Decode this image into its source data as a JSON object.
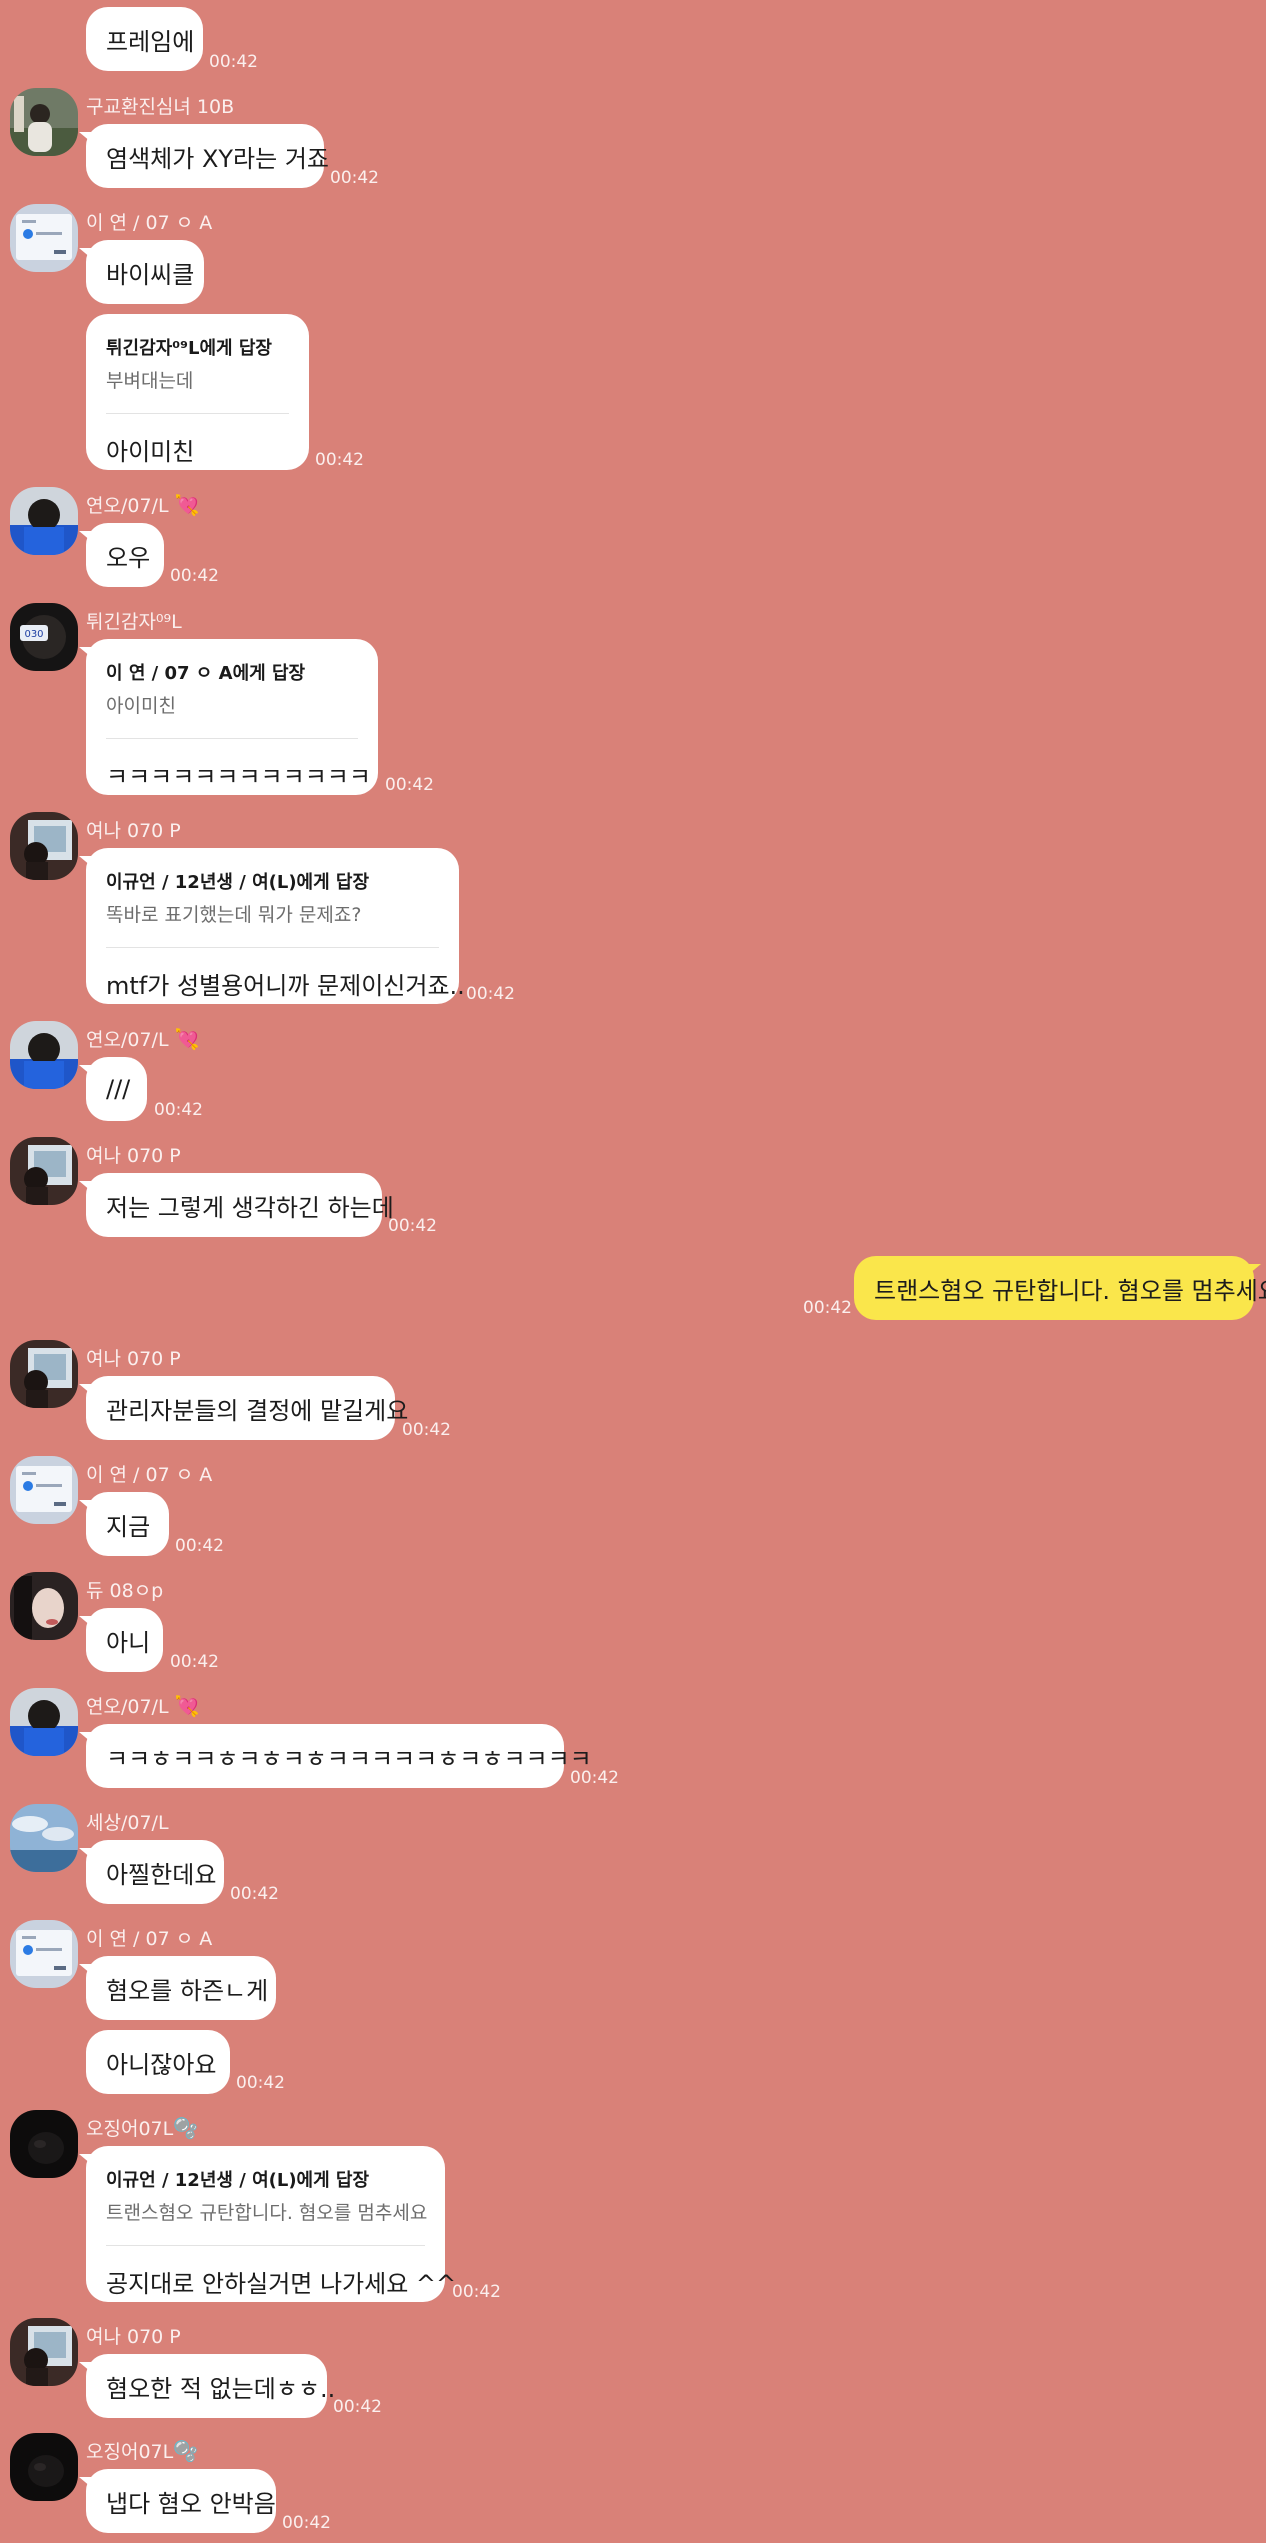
{
  "messages": [
    {
      "text": "프레임에",
      "time": "00:42"
    },
    {
      "sender": "구교환진심녀 10B",
      "text": "염색체가 XY라는 거죠",
      "time": "00:42"
    },
    {
      "sender": "이 연 / 07 ㅇ A",
      "text": "바이씨클"
    },
    {
      "reply_to": "튀긴감자⁰⁹L에게 답장",
      "quote": "부벼대는데",
      "text": "아이미친",
      "time": "00:42"
    },
    {
      "sender": "연오/07/L",
      "sender_icon": "heart-icon",
      "text": "오우",
      "time": "00:42"
    },
    {
      "sender": "튀긴감자⁰⁹L",
      "reply_to": "이 연 / 07 ㅇ A에게 답장",
      "quote": "아이미친",
      "text": "ㅋㅋㅋㅋㅋㅋㅋㅋㅋㅋㅋㅋ",
      "time": "00:42"
    },
    {
      "sender": "여나 070 P",
      "reply_to": "이규언 / 12년생 / 여(L)에게 답장",
      "quote": "똑바로 표기했는데 뭐가 문제죠?",
      "text": "mtf가 성별용어니까 문제이신거죠..",
      "time": "00:42"
    },
    {
      "sender": "연오/07/L",
      "sender_icon": "heart-icon",
      "text": "///",
      "time": "00:42"
    },
    {
      "sender": "여나 070 P",
      "text": "저는 그렇게 생각하긴 하는데",
      "time": "00:42"
    },
    {
      "mine": true,
      "text": "트랜스혐오 규탄합니다. 혐오를 멈추세요",
      "time": "00:42"
    },
    {
      "sender": "여나 070 P",
      "text": "관리자분들의 결정에 맡길게요",
      "time": "00:42"
    },
    {
      "sender": "이 연 / 07 ㅇ A",
      "text": "지금",
      "time": "00:42"
    },
    {
      "sender": "듀 08ㅇp",
      "text": "아니",
      "time": "00:42"
    },
    {
      "sender": "연오/07/L",
      "sender_icon": "heart-icon",
      "text": "ㅋㅋㅎㅋㅋㅎㅋㅎㅋㅎㅋㅋㅋㅋㅋㅎㅋㅎㅋㅋㅋㅋ",
      "time": "00:42"
    },
    {
      "sender": "세상/07/L",
      "text": "아찔한데요",
      "time": "00:42"
    },
    {
      "sender": "이 연 / 07 ㅇ A",
      "text": "혐오를 하즌ㄴ게"
    },
    {
      "text": "아니잖아요",
      "time": "00:42"
    },
    {
      "sender": "오징어07L",
      "sender_icon": "bubbles-icon",
      "reply_to": "이규언 / 12년생 / 여(L)에게 답장",
      "quote": "트랜스혐오 규탄합니다. 혐오를 멈추세요",
      "text": "공지대로 안하실거면 나가세요 ^^",
      "time": "00:42"
    },
    {
      "sender": "여나 070 P",
      "text": "혐오한 적 없는데ㅎㅎ..",
      "time": "00:42"
    },
    {
      "sender": "오징어07L",
      "sender_icon": "bubbles-icon",
      "text": "냅다 혐오 안박음",
      "time": "00:42"
    }
  ],
  "colors": {
    "background": "#d98178",
    "bubble": "#ffffff",
    "my_bubble": "#fae64b"
  }
}
